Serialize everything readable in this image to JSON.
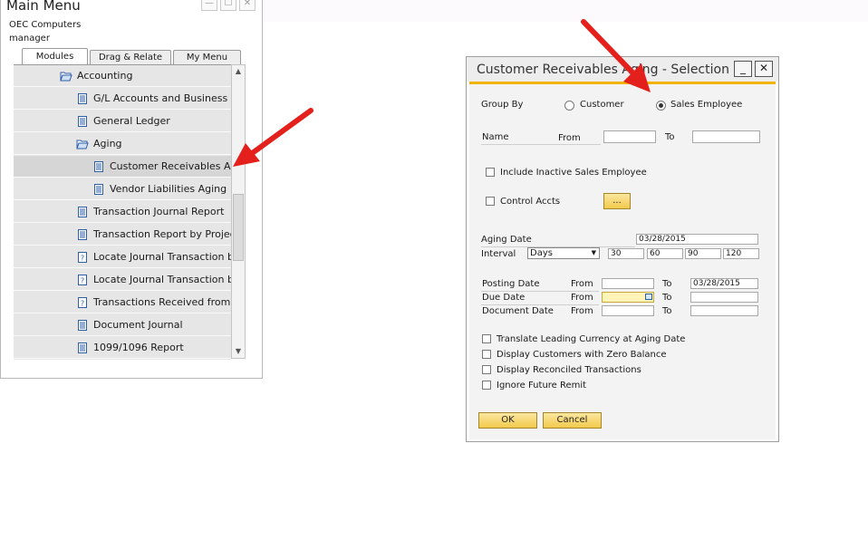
{
  "main_menu": {
    "title": "Main Menu",
    "company": "OEC Computers",
    "user": "manager",
    "window_buttons": {
      "minimize": "—",
      "maximize": "☐",
      "close": "✕"
    },
    "tabs": [
      "Modules",
      "Drag & Relate",
      "My Menu"
    ],
    "tree": [
      {
        "label": "Accounting",
        "icon": "folder-open-icon"
      },
      {
        "label": "G/L Accounts and Business Partners",
        "icon": "document-icon"
      },
      {
        "label": "General Ledger",
        "icon": "document-icon"
      },
      {
        "label": "Aging",
        "icon": "folder-open-icon"
      },
      {
        "label": "Customer Receivables Aging",
        "icon": "document-icon"
      },
      {
        "label": "Vendor Liabilities Aging",
        "icon": "document-icon"
      },
      {
        "label": "Transaction Journal Report",
        "icon": "document-icon"
      },
      {
        "label": "Transaction Report by Projects",
        "icon": "document-icon"
      },
      {
        "label": "Locate Journal Transaction by Amount Range",
        "icon": "query-icon"
      },
      {
        "label": "Locate Journal Transaction by FC Amount Range",
        "icon": "query-icon"
      },
      {
        "label": "Transactions Received from Voucher",
        "icon": "query-icon"
      },
      {
        "label": "Document Journal",
        "icon": "document-icon"
      },
      {
        "label": "1099/1096 Report",
        "icon": "document-icon"
      }
    ]
  },
  "dialog": {
    "title": "Customer Receivables Aging - Selection Criteria",
    "window_buttons": {
      "minimize": "_",
      "close": "✕"
    },
    "group_by": {
      "label": "Group By",
      "options": [
        "Customer",
        "Sales Employee"
      ],
      "selected": "Sales Employee"
    },
    "name": {
      "label": "Name",
      "from_label": "From",
      "to_label": "To",
      "from": "",
      "to": ""
    },
    "include_inactive": {
      "label": "Include Inactive Sales Employee",
      "checked": false
    },
    "control_accts": {
      "label": "Control Accts",
      "checked": false,
      "button": "..."
    },
    "aging_date": {
      "label": "Aging Date",
      "value": "03/28/2015"
    },
    "interval": {
      "label": "Interval",
      "unit": "Days",
      "values": [
        "30",
        "60",
        "90",
        "120"
      ]
    },
    "posting_date": {
      "label": "Posting Date",
      "from_label": "From",
      "to_label": "To",
      "from": "",
      "to": "03/28/2015"
    },
    "due_date": {
      "label": "Due Date",
      "from_label": "From",
      "to_label": "To",
      "from": "",
      "to": ""
    },
    "document_date": {
      "label": "Document Date",
      "from_label": "From",
      "to_label": "To",
      "from": "",
      "to": ""
    },
    "options": [
      {
        "label": "Translate Leading Currency at Aging Date",
        "checked": false
      },
      {
        "label": "Display Customers with Zero Balance",
        "checked": false
      },
      {
        "label": "Display Reconciled Transactions",
        "checked": false
      },
      {
        "label": "Ignore Future Remit",
        "checked": false
      }
    ],
    "buttons": {
      "ok": "OK",
      "cancel": "Cancel"
    }
  },
  "colors": {
    "accent": "#f0b400",
    "annotation_arrow": "#e3201b",
    "tree_bg": "#e6e6e6"
  }
}
